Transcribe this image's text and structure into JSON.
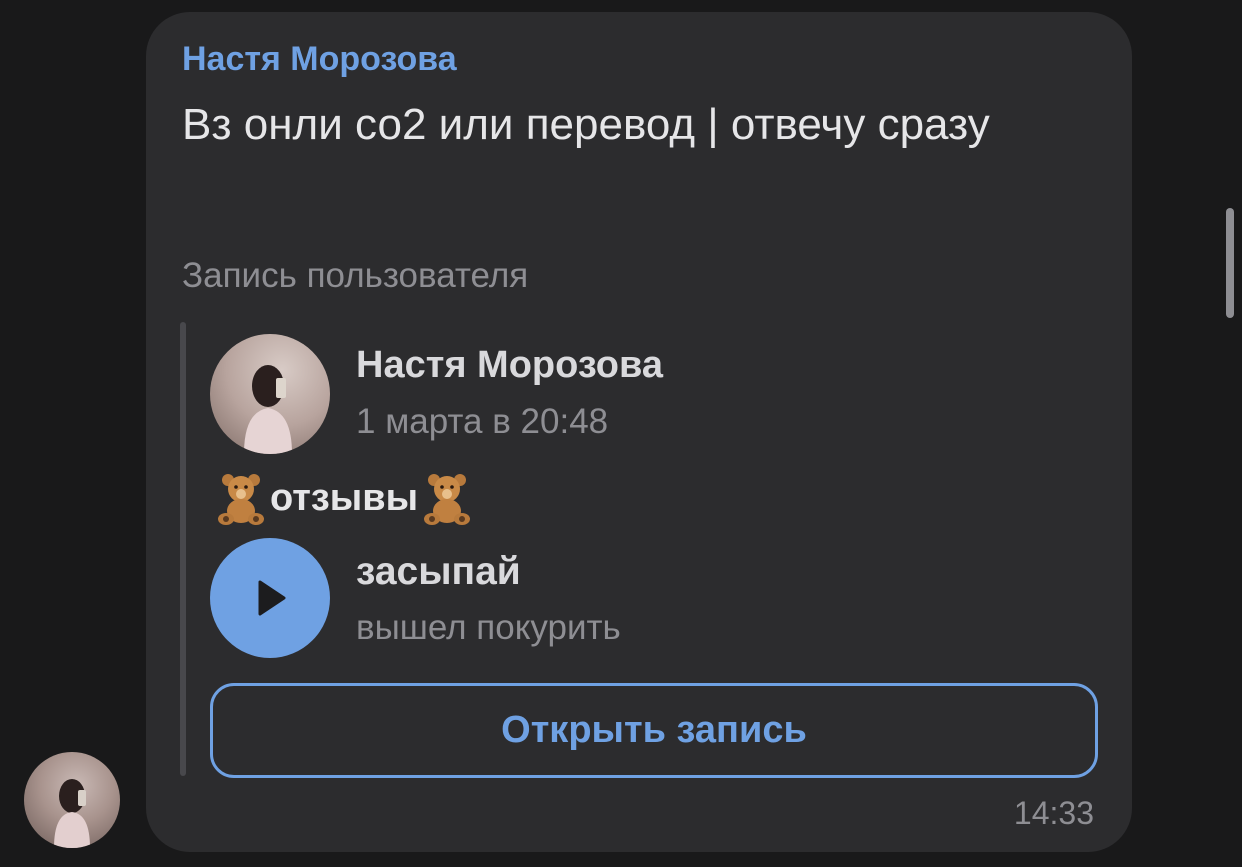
{
  "message": {
    "author": "Настя Морозова",
    "text": "Вз онли со2 или перевод | отвечу сразу",
    "repost_caption": "Запись пользователя",
    "time": "14:33"
  },
  "repost": {
    "author": "Настя Морозова",
    "date": "1 марта в 20:48",
    "text": "отзывы",
    "text_icon": "teddy-bear-icon",
    "audio": {
      "title": "засыпай",
      "artist": "вышел покурить",
      "icon": "play-icon"
    },
    "open_button_label": "Открыть запись"
  },
  "colors": {
    "background": "#19191a",
    "bubble": "#2c2c2e",
    "accent": "#6fa1e3",
    "primary_text": "#e6e6e8",
    "secondary_text": "#8e8e93"
  }
}
